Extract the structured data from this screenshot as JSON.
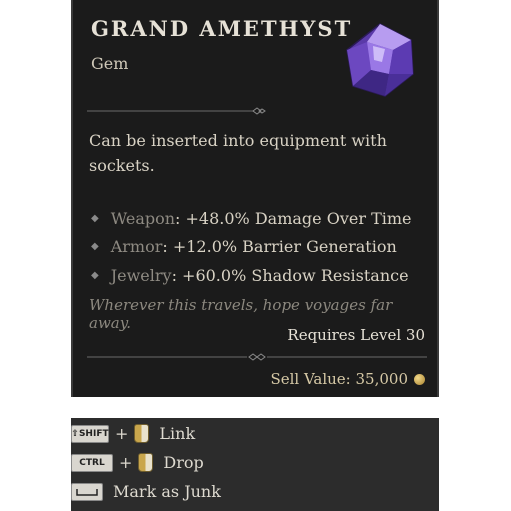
{
  "item": {
    "name": "GRAND AMETHYST",
    "type": "Gem",
    "description": "Can be inserted into equipment with sockets.",
    "stats": [
      {
        "slot": "Weapon",
        "value": ": +48.0% Damage Over Time"
      },
      {
        "slot": "Armor",
        "value": ": +12.0% Barrier Generation"
      },
      {
        "slot": "Jewelry",
        "value": ": +60.0% Shadow Resistance"
      }
    ],
    "flavor_text": "Wherever this travels, hope voyages far away.",
    "requirement": "Requires Level 30",
    "sell_value": "Sell Value: 35,000",
    "icon": "amethyst-gem-icon"
  },
  "controls": [
    {
      "key": "SHIFT",
      "plus": "+",
      "mouse": "mouse-click-icon",
      "label": "Link"
    },
    {
      "key": "CTRL",
      "plus": "+",
      "mouse": "mouse-click-icon",
      "label": "Drop"
    },
    {
      "key": "",
      "label": "Mark as Junk"
    }
  ],
  "colors": {
    "panel_bg": "#1b1b1b",
    "gem_purple": "#7b4fd0",
    "title": "#e6e1d6"
  }
}
